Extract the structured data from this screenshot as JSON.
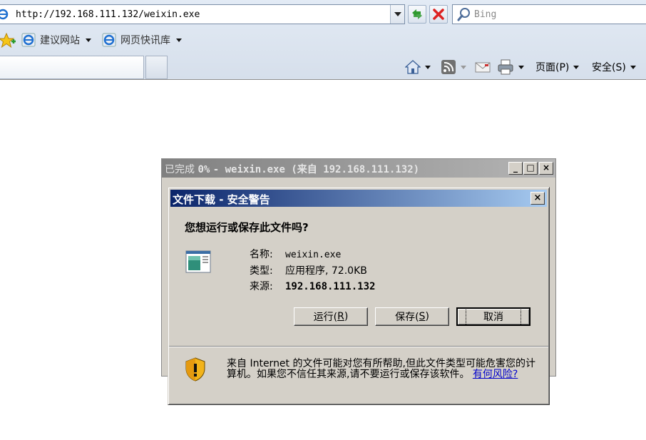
{
  "browser": {
    "address": "http://192.168.111.132/weixin.exe",
    "search_placeholder": "Bing",
    "favorites": [
      {
        "label": "建议网站"
      },
      {
        "label": "网页快讯库"
      }
    ],
    "commands": {
      "page_label": "页面(P)",
      "safety_label": "安全(S)"
    }
  },
  "progress_window": {
    "title_prefix": "已完成",
    "title_percent": "0%",
    "title_rest": "- weixin.exe (来自 192.168.111.132)",
    "minimize": "_",
    "maximize": "□",
    "close": "×"
  },
  "dialog": {
    "title": "文件下载 - 安全警告",
    "close": "×",
    "question": "您想运行或保存此文件吗?",
    "fields": {
      "name_label": "名称:",
      "name_value": "weixin.exe",
      "type_label": "类型:",
      "type_value": "应用程序, 72.0KB",
      "source_label": "来源:",
      "source_value": "192.168.111.132"
    },
    "buttons": {
      "run_label": "运行(",
      "run_key": "R",
      "save_label": "保存(",
      "save_key": "S",
      "close_paren": ")",
      "cancel_label": "取消"
    },
    "warning": "来自 Internet 的文件可能对您有所帮助,但此文件类型可能危害您的计算机。如果您不信任其来源,请不要运行或保存该软件。",
    "risk_link": "有何风险?"
  }
}
